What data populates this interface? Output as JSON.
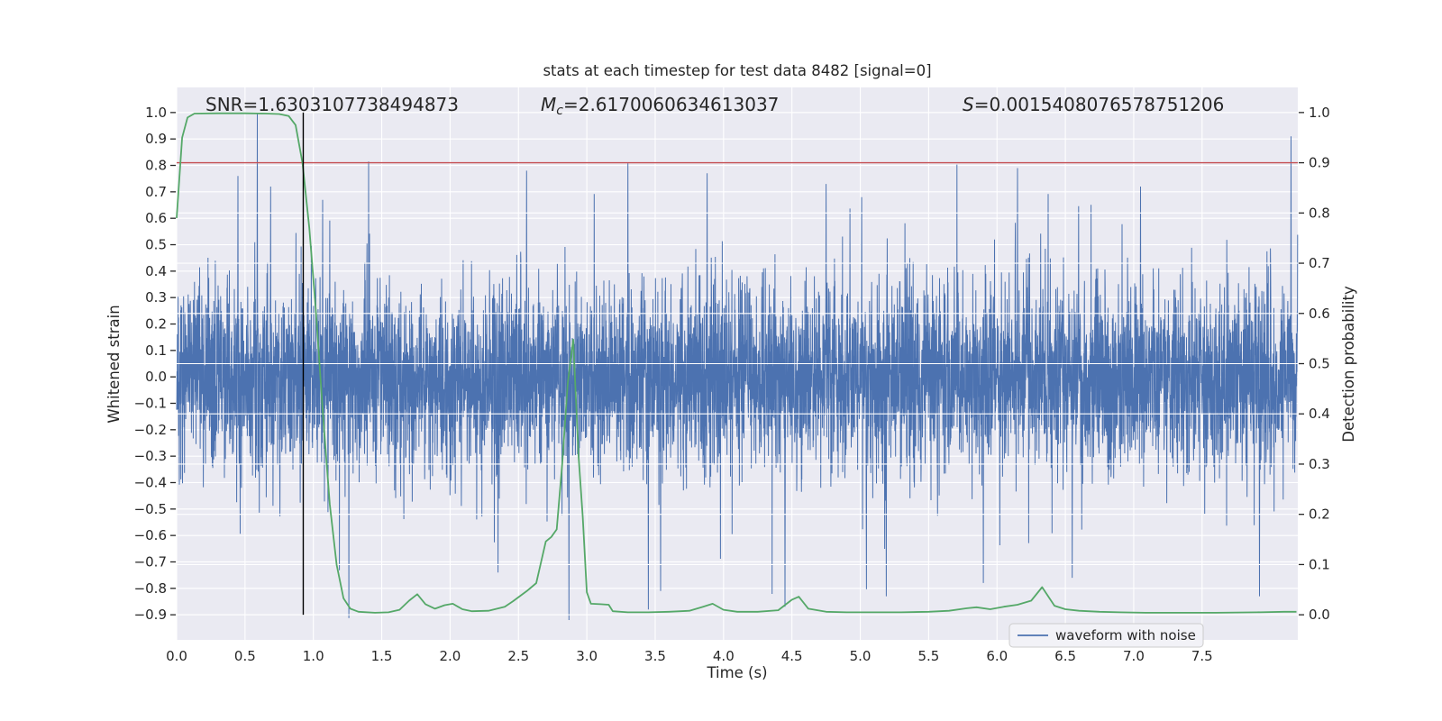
{
  "chart_data": {
    "type": "line",
    "title": "stats at each timestep for test data 8482 [signal=0]",
    "xlabel": "Time (s)",
    "ylabel_left": "Whitened strain",
    "ylabel_right": "Detection probability",
    "xlim": [
      0,
      8.2
    ],
    "ylim_left": [
      -0.995,
      1.095
    ],
    "ylim_right": [
      -0.05,
      1.05
    ],
    "xticks": [
      0.0,
      0.5,
      1.0,
      1.5,
      2.0,
      2.5,
      3.0,
      3.5,
      4.0,
      4.5,
      5.0,
      5.5,
      6.0,
      6.5,
      7.0,
      7.5
    ],
    "yticks_left": [
      1.0,
      0.9,
      0.8,
      0.7,
      0.6,
      0.5,
      0.4,
      0.3,
      0.2,
      0.1,
      0.0,
      -0.1,
      -0.2,
      -0.3,
      -0.4,
      -0.5,
      -0.6,
      -0.7,
      -0.8,
      -0.9
    ],
    "yticks_right": [
      1.0,
      0.9,
      0.8,
      0.7,
      0.6,
      0.5,
      0.4,
      0.3,
      0.2,
      0.1,
      0.0
    ],
    "grid": true,
    "annotations": [
      {
        "id": "snr",
        "text": "SNR=1.6303107738494873"
      },
      {
        "id": "chirp-mass",
        "prefix": "M",
        "sub": "c",
        "rest": "=2.6170060634613037"
      },
      {
        "id": "significance",
        "prefix": "S",
        "rest": "=0.0015408076578751206"
      }
    ],
    "threshold_line": {
      "axis": "right",
      "value": 0.9,
      "color": "#c44e52"
    },
    "event_marker": {
      "x": 0.926,
      "span_left_axis": [
        -0.9,
        1.0
      ],
      "color": "#000000"
    },
    "series": [
      {
        "name": "waveform with noise",
        "axis": "left",
        "color": "#4c72b0",
        "kind": "noise",
        "n": 6144,
        "sigma": 0.17,
        "tail_sigma": 0.34,
        "tail_fraction": 0.03,
        "seed": 8482,
        "extremes": [
          [
            0.448,
            0.76
          ],
          [
            0.59,
            1.0
          ],
          [
            0.687,
            0.72
          ],
          [
            1.068,
            0.67
          ],
          [
            2.35,
            -0.74
          ],
          [
            2.56,
            0.78
          ],
          [
            2.87,
            -0.92
          ],
          [
            3.3,
            0.81
          ],
          [
            3.45,
            -0.88
          ],
          [
            3.54,
            -0.81
          ],
          [
            3.88,
            0.77
          ],
          [
            4.45,
            -0.87
          ],
          [
            4.75,
            0.73
          ],
          [
            5.01,
            0.68
          ],
          [
            5.19,
            -0.83
          ],
          [
            5.9,
            -0.78
          ],
          [
            6.15,
            0.79
          ],
          [
            6.55,
            -0.76
          ],
          [
            7.05,
            0.72
          ],
          [
            7.92,
            -0.83
          ],
          [
            8.15,
            0.91
          ]
        ]
      },
      {
        "name": "detection probability",
        "axis": "right",
        "color": "#55a868",
        "kind": "points",
        "points": [
          [
            0,
            0.79
          ],
          [
            0.04,
            0.95
          ],
          [
            0.08,
            0.99
          ],
          [
            0.13,
            0.998
          ],
          [
            0.3,
            0.9985
          ],
          [
            0.5,
            0.9985
          ],
          [
            0.65,
            0.998
          ],
          [
            0.75,
            0.997
          ],
          [
            0.82,
            0.993
          ],
          [
            0.87,
            0.975
          ],
          [
            0.92,
            0.9
          ],
          [
            0.97,
            0.77
          ],
          [
            1.02,
            0.6
          ],
          [
            1.07,
            0.4
          ],
          [
            1.12,
            0.22
          ],
          [
            1.17,
            0.1
          ],
          [
            1.22,
            0.033
          ],
          [
            1.27,
            0.012
          ],
          [
            1.33,
            0.006
          ],
          [
            1.45,
            0.004
          ],
          [
            1.55,
            0.005
          ],
          [
            1.63,
            0.01
          ],
          [
            1.7,
            0.028
          ],
          [
            1.76,
            0.041
          ],
          [
            1.82,
            0.021
          ],
          [
            1.89,
            0.012
          ],
          [
            1.96,
            0.019
          ],
          [
            2.02,
            0.022
          ],
          [
            2.09,
            0.011
          ],
          [
            2.16,
            0.007
          ],
          [
            2.28,
            0.008
          ],
          [
            2.4,
            0.016
          ],
          [
            2.46,
            0.027
          ],
          [
            2.56,
            0.047
          ],
          [
            2.63,
            0.063
          ],
          [
            2.7,
            0.146
          ],
          [
            2.74,
            0.155
          ],
          [
            2.78,
            0.17
          ],
          [
            2.82,
            0.3
          ],
          [
            2.86,
            0.46
          ],
          [
            2.9,
            0.548
          ],
          [
            2.94,
            0.315
          ],
          [
            2.97,
            0.195
          ],
          [
            3.0,
            0.045
          ],
          [
            3.03,
            0.022
          ],
          [
            3.1,
            0.021
          ],
          [
            3.16,
            0.02
          ],
          [
            3.19,
            0.007
          ],
          [
            3.3,
            0.005
          ],
          [
            3.45,
            0.005
          ],
          [
            3.6,
            0.006
          ],
          [
            3.75,
            0.008
          ],
          [
            3.85,
            0.016
          ],
          [
            3.92,
            0.022
          ],
          [
            4.0,
            0.01
          ],
          [
            4.1,
            0.006
          ],
          [
            4.25,
            0.006
          ],
          [
            4.4,
            0.009
          ],
          [
            4.5,
            0.03
          ],
          [
            4.55,
            0.036
          ],
          [
            4.62,
            0.012
          ],
          [
            4.75,
            0.006
          ],
          [
            4.9,
            0.005
          ],
          [
            5.1,
            0.005
          ],
          [
            5.3,
            0.005
          ],
          [
            5.5,
            0.006
          ],
          [
            5.65,
            0.008
          ],
          [
            5.78,
            0.013
          ],
          [
            5.85,
            0.015
          ],
          [
            5.95,
            0.011
          ],
          [
            6.05,
            0.016
          ],
          [
            6.15,
            0.02
          ],
          [
            6.25,
            0.028
          ],
          [
            6.33,
            0.055
          ],
          [
            6.42,
            0.018
          ],
          [
            6.5,
            0.011
          ],
          [
            6.6,
            0.008
          ],
          [
            6.75,
            0.006
          ],
          [
            6.9,
            0.005
          ],
          [
            7.1,
            0.004
          ],
          [
            7.3,
            0.004
          ],
          [
            7.6,
            0.004
          ],
          [
            7.9,
            0.005
          ],
          [
            8.1,
            0.006
          ],
          [
            8.19,
            0.006
          ]
        ]
      }
    ],
    "legend": {
      "position": "lower-right",
      "entries": [
        {
          "label": "waveform with noise",
          "color": "#4c72b0"
        }
      ]
    },
    "colors": {
      "figure_bg": "#ffffff",
      "axes_bg": "#eaeaf2",
      "grid": "#ffffff",
      "text": "#262626",
      "legend_bg": "#f2f2f7",
      "legend_border": "#cccccc"
    },
    "layout": {
      "axes_rect": [
        196,
        97,
        1244,
        613
      ],
      "legend_rect": [
        1120,
        692,
        215,
        26
      ]
    }
  }
}
